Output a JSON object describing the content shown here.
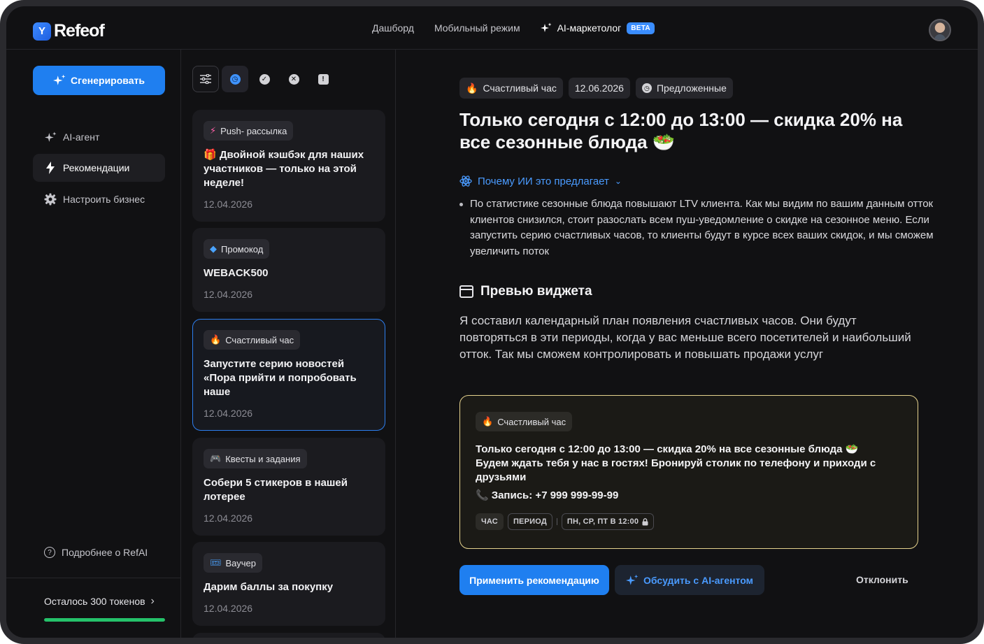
{
  "brand": {
    "name": "Refeof",
    "mark": "Y"
  },
  "nav": {
    "dashboard": "Дашборд",
    "mobile": "Мобильный режим",
    "ai": "AI-маркетолог",
    "beta": "BETA"
  },
  "sidebar": {
    "generate": "Сгенерировать",
    "items": [
      {
        "label": "AI-агент",
        "icon": "sparkle-icon"
      },
      {
        "label": "Рекомендации",
        "icon": "lightning-icon"
      },
      {
        "label": "Настроить бизнес",
        "icon": "gear-icon"
      }
    ],
    "help": "Подробнее о RefAI",
    "tokens": "Осталось 300 токенов",
    "tokens_progress": 1.0
  },
  "list": {
    "cards": [
      {
        "tag_icon": "⚡",
        "tag": "Push- рассылка",
        "title": "🎁 Двойной кэшбэк для наших участников — только на этой неделе!",
        "date": "12.04.2026"
      },
      {
        "tag_icon": "◆",
        "tag": "Промокод",
        "title": "WEBACK500",
        "date": "12.04.2026"
      },
      {
        "tag_icon": "🔥",
        "tag": "Счастливый час",
        "title": "Запустите серию новостей «Пора прийти и попробовать наше",
        "date": "12.04.2026"
      },
      {
        "tag_icon": "🎮",
        "tag": "Квесты и задания",
        "title": "Собери 5 стикеров в нашей лотерее",
        "date": "12.04.2026"
      },
      {
        "tag_icon": "🎟",
        "tag": "Ваучер",
        "title": "Дарим баллы за покупку",
        "date": "12.04.2026"
      }
    ]
  },
  "detail": {
    "chips": {
      "type": "Счастливый час",
      "date": "12.06.2026",
      "status": "Предложенные"
    },
    "headline": "Только сегодня с 12:00 до 13:00 — скидка 20% на все сезонные блюда 🥗",
    "why": "Почему ИИ это предлагает",
    "reason": "По статистике сезонные блюда повышают LTV клиента. Как мы видим по вашим данным отток клиентов снизился, стоит разослать всем пуш-уведомление о скидке на сезонное меню. Если запустить серию счастливых часов, то клиенты будут в курсе всех ваших скидок, и мы сможем увеличить поток",
    "preview_title": "Превью виджета",
    "preview_text": "Я составил календарный план появления счастливых часов. Они будут повторяться в эти периоды, когда у вас меньше всего посетителей и наибольший отток. Так мы сможем контролировать и повышать продажи услуг",
    "widget": {
      "tag": "Счастливый час",
      "text": "Только сегодня с 12:00 до 13:00 — скидка 20% на все сезонные блюда 🥗 Будем ждать тебя у нас в гостях! Бронируй столик по телефону и приходи с друзьями",
      "phone": "Запись: +7 999 999-99-99",
      "pills": {
        "hour": "ЧАС",
        "period": "ПЕРИОД",
        "schedule": "ПН, СР, ПТ В 12:00"
      }
    },
    "actions": {
      "apply": "Применить рекомендацию",
      "discuss": "Обсудить с AI-агентом",
      "reject": "Отклонить"
    }
  },
  "colors": {
    "accent": "#1f7ff0",
    "link": "#4a9bff",
    "widget_border": "#e6d38e",
    "progress": "#25c26a"
  }
}
